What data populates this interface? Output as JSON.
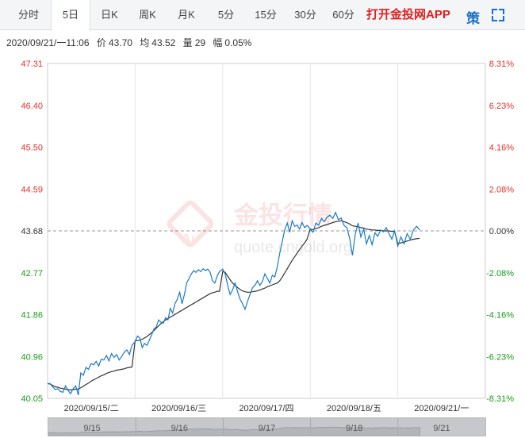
{
  "toolbar": {
    "tabs": [
      {
        "label": "分时"
      },
      {
        "label": "5日"
      },
      {
        "label": "日K"
      },
      {
        "label": "周K"
      },
      {
        "label": "月K"
      },
      {
        "label": "5分"
      },
      {
        "label": "15分"
      },
      {
        "label": "30分"
      },
      {
        "label": "60分"
      }
    ],
    "active_tab": "5日",
    "app_link": "打开金投网APP",
    "strategy_label": "策"
  },
  "info_bar": {
    "time": "2020/09/21/一11:06",
    "price_label": "价",
    "price": "43.70",
    "avg_label": "均",
    "avg": "43.52",
    "volume_label": "量",
    "volume": "29",
    "change_label": "幅",
    "change": "0.05%"
  },
  "watermark": {
    "logo_text": "金投行情",
    "url_text": "quote.cngold.org"
  },
  "colors": {
    "price_line": "#1a7bc6",
    "avg_line": "#333333",
    "up": "#e5322d",
    "down": "#1a9c1a",
    "flat": "#333333"
  },
  "chart_data": {
    "type": "line",
    "series": [
      {
        "name": "价",
        "role": "price"
      },
      {
        "name": "均",
        "role": "average"
      }
    ],
    "prev_close": 43.68,
    "ylim": [
      40.05,
      47.31
    ],
    "y_ticks_left": [
      "47.31",
      "46.40",
      "45.50",
      "44.59",
      "43.68",
      "42.77",
      "41.86",
      "40.96",
      "40.05"
    ],
    "y_ticks_right": [
      "8.31%",
      "6.23%",
      "4.16%",
      "2.08%",
      "0.00%",
      "-2.08%",
      "-4.16%",
      "-6.23%",
      "-8.31%"
    ],
    "x_tick_labels": [
      "2020/09/15/二",
      "2020/09/16/三",
      "2020/09/17/四",
      "2020/09/18/五",
      "2020/09/21/一"
    ],
    "nav_labels": [
      "9/15",
      "9/16",
      "9/17",
      "9/18",
      "9/21"
    ],
    "days": [
      {
        "date": "2020/09/15",
        "price": [
          40.37,
          40.37,
          40.3,
          40.24,
          40.26,
          40.2,
          40.18,
          40.32,
          40.22,
          40.15,
          40.26,
          40.32,
          40.12,
          40.6,
          40.55,
          40.72,
          40.68,
          40.8,
          40.78,
          40.85,
          40.75,
          40.9,
          40.88,
          40.98,
          40.86,
          41.02,
          40.94,
          41.0,
          40.88,
          40.96,
          41.05,
          41.1,
          41.0,
          41.2
        ],
        "avg": [
          40.37,
          40.36,
          40.33,
          40.3,
          40.29,
          40.27,
          40.26,
          40.25,
          40.24,
          40.23,
          40.24,
          40.25,
          40.25,
          40.28,
          40.31,
          40.35,
          40.38,
          40.42,
          40.45,
          40.48,
          40.51,
          40.54,
          40.56,
          40.59,
          40.61,
          40.63,
          40.64,
          40.66,
          40.67,
          40.68,
          40.69,
          40.71,
          40.72,
          40.73
        ]
      },
      {
        "date": "2020/09/16",
        "price": [
          41.28,
          41.4,
          41.36,
          41.15,
          41.24,
          41.2,
          41.3,
          41.42,
          41.55,
          41.6,
          41.75,
          41.7,
          41.68,
          41.8,
          41.75,
          42.0,
          41.9,
          42.1,
          42.2,
          42.35,
          42.1,
          42.3,
          42.55,
          42.65,
          42.75,
          42.82,
          42.78,
          42.84,
          42.8,
          42.86,
          42.82,
          42.85,
          42.78,
          42.6,
          42.55,
          42.7,
          42.8
        ],
        "avg": [
          41.3,
          41.3,
          41.31,
          41.33,
          41.36,
          41.39,
          41.43,
          41.47,
          41.52,
          41.57,
          41.62,
          41.67,
          41.71,
          41.75,
          41.78,
          41.81,
          41.84,
          41.87,
          41.9,
          41.93,
          41.96,
          41.99,
          42.02,
          42.05,
          42.08,
          42.11,
          42.14,
          42.17,
          42.2,
          42.23,
          42.26,
          42.29,
          42.32,
          42.34,
          42.35,
          42.37,
          42.37
        ]
      },
      {
        "date": "2020/09/17",
        "price": [
          42.85,
          42.75,
          42.5,
          42.3,
          42.4,
          42.55,
          42.36,
          42.2,
          42.1,
          41.98,
          42.15,
          42.3,
          42.45,
          42.5,
          42.6,
          42.5,
          42.58,
          42.75,
          42.65,
          42.55,
          42.72,
          42.68,
          42.9,
          43.2,
          43.45,
          43.7,
          43.85,
          43.65,
          43.9,
          43.78,
          43.8,
          43.72,
          43.86,
          43.75,
          43.8
        ],
        "avg": [
          42.8,
          42.78,
          42.7,
          42.62,
          42.55,
          42.5,
          42.45,
          42.41,
          42.38,
          42.36,
          42.35,
          42.35,
          42.36,
          42.37,
          42.38,
          42.4,
          42.42,
          42.44,
          42.47,
          42.49,
          42.51,
          42.53,
          42.55,
          42.6,
          42.68,
          42.77,
          42.86,
          42.95,
          43.04,
          43.12,
          43.2,
          43.28,
          43.35,
          43.42,
          43.5
        ]
      },
      {
        "date": "2020/09/18",
        "price": [
          43.72,
          43.65,
          43.85,
          43.8,
          43.95,
          43.88,
          43.98,
          44.02,
          43.95,
          44.08,
          43.92,
          43.96,
          43.8,
          43.75,
          43.52,
          43.15,
          43.6,
          43.85,
          43.55,
          43.72,
          43.4,
          43.58,
          43.38,
          43.64,
          43.56,
          43.7,
          43.66,
          43.75,
          43.62,
          43.5,
          43.68
        ],
        "avg": [
          43.72,
          43.71,
          43.73,
          43.75,
          43.78,
          43.8,
          43.82,
          43.84,
          43.86,
          43.88,
          43.89,
          43.9,
          43.88,
          43.86,
          43.83,
          43.79,
          43.78,
          43.77,
          43.75,
          43.74,
          43.72,
          43.71,
          43.7,
          43.7,
          43.69,
          43.69,
          43.68,
          43.68,
          43.68,
          43.67,
          43.67
        ]
      },
      {
        "date": "2020/09/21",
        "price": [
          43.35,
          43.55,
          43.4,
          43.62,
          43.5,
          43.7,
          43.78,
          43.7
        ],
        "avg": [
          43.4,
          43.42,
          43.44,
          43.46,
          43.48,
          43.5,
          43.51,
          43.52
        ]
      }
    ]
  }
}
